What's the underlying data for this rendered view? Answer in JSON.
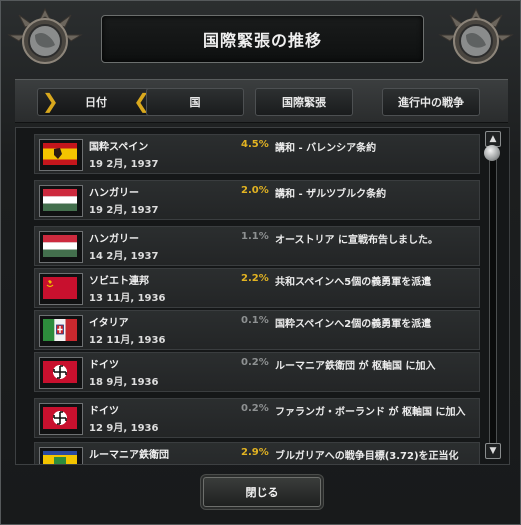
{
  "window": {
    "title": "国際緊張の推移"
  },
  "tabs": [
    {
      "label": "日付",
      "active": true
    },
    {
      "label": "国"
    },
    {
      "label": "国際緊張"
    },
    {
      "label": "進行中の戦争"
    }
  ],
  "rows": [
    {
      "country": "国粋スペイン",
      "date": "19 2月, 1937",
      "tension": "4.5%",
      "level": "hi",
      "event": "講和 - バレンシア条約",
      "flag": "flag-nationalist-spain"
    },
    {
      "country": "ハンガリー",
      "date": "19 2月, 1937",
      "tension": "2.0%",
      "level": "hi",
      "event": "講和 - ザルツブルク条約",
      "flag": "flag-hungary"
    },
    {
      "country": "ハンガリー",
      "date": "14 2月, 1937",
      "tension": "1.1%",
      "level": "lo",
      "event": "オーストリア に宣戦布告しました。",
      "flag": "flag-hungary"
    },
    {
      "country": "ソビエト連邦",
      "date": "13 11月, 1936",
      "tension": "2.2%",
      "level": "hi",
      "event": "共和スペインへ5個の義勇軍を派遣",
      "flag": "flag-soviet-union"
    },
    {
      "country": "イタリア",
      "date": "12 11月, 1936",
      "tension": "0.1%",
      "level": "lo",
      "event": "国粋スペインへ2個の義勇軍を派遣",
      "flag": "flag-italy"
    },
    {
      "country": "ドイツ",
      "date": "18 9月, 1936",
      "tension": "0.2%",
      "level": "lo",
      "event": "ルーマニア鉄衛団 が 枢軸国 に加入",
      "flag": "flag-germany"
    },
    {
      "country": "ドイツ",
      "date": "12 9月, 1936",
      "tension": "0.2%",
      "level": "lo",
      "event": "ファランガ・ボーランド が 枢軸国 に加入",
      "flag": "flag-germany"
    },
    {
      "country": "ルーマニア鉄衛団",
      "date": "",
      "tension": "2.9%",
      "level": "hi",
      "event": "ブルガリアへの戦争目標(3.72)を正当化",
      "flag": "flag-romania"
    }
  ],
  "scroll": {
    "up": "▲",
    "down": "▼"
  },
  "footer": {
    "close_label": "閉じる"
  },
  "colors": {
    "accent_gold": "#e2b322",
    "muted": "#8e9192"
  }
}
